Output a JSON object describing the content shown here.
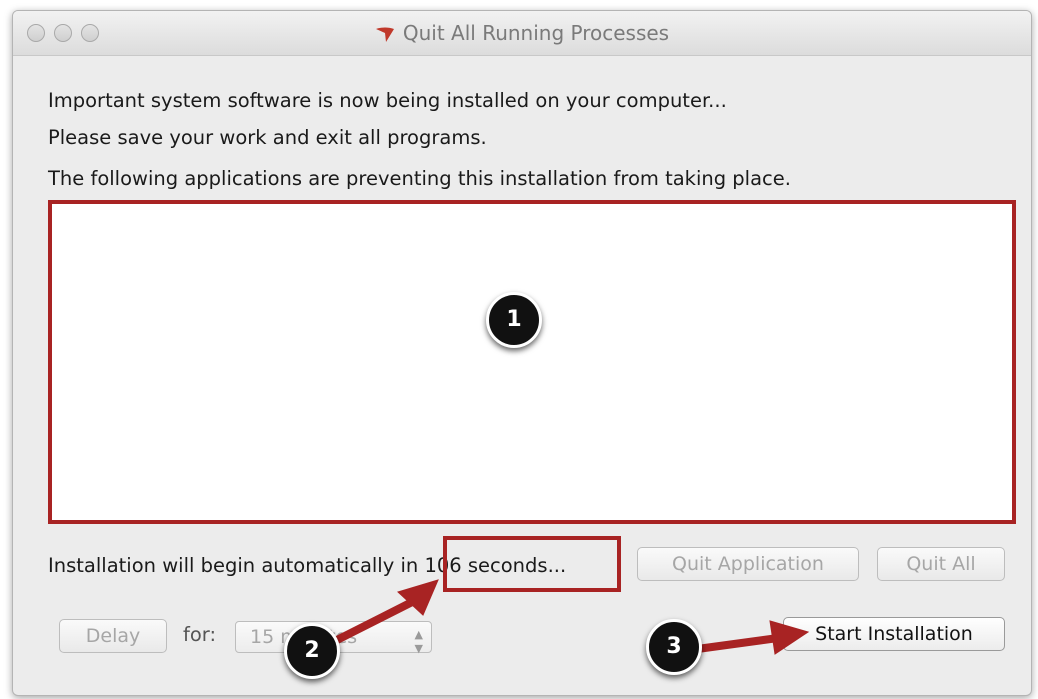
{
  "window": {
    "title": "Quit All Running Processes"
  },
  "messages": {
    "line1": "Important system software is now being installed on your computer...",
    "line2": "Please save your work and exit all programs.",
    "line3": "The following applications are preventing this installation from taking place."
  },
  "applications": [],
  "countdown": {
    "prefix": "Installation will begin automatically in",
    "value": "106 seconds..."
  },
  "buttons": {
    "quit_application": "Quit Application",
    "quit_all": "Quit All",
    "delay": "Delay",
    "start_installation": "Start Installation"
  },
  "delay": {
    "for_label": "for:",
    "selected": "15 minutes"
  },
  "callouts": [
    "1",
    "2",
    "3"
  ],
  "colors": {
    "annotation": "#a82323",
    "window_bg": "#ececec"
  }
}
